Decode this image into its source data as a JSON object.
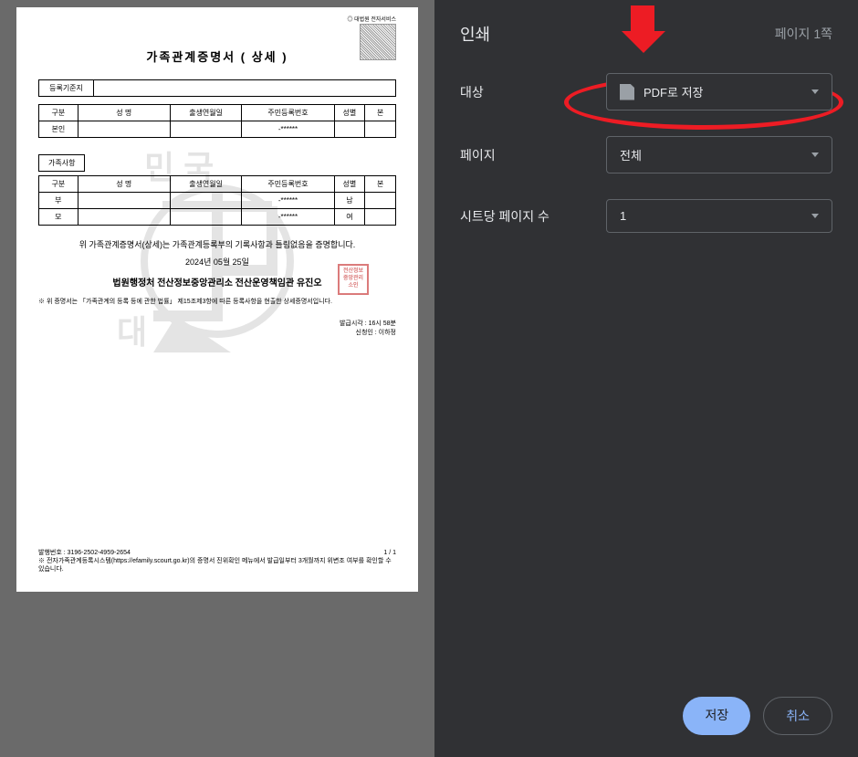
{
  "panel": {
    "title": "인쇄",
    "page_count": "페이지 1쪽",
    "destination_label": "대상",
    "destination_value": "PDF로 저장",
    "pages_label": "페이지",
    "pages_value": "전체",
    "per_sheet_label": "시트당 페이지 수",
    "per_sheet_value": "1",
    "save_btn": "저장",
    "cancel_btn": "취소"
  },
  "doc": {
    "title": "가족관계증명서 ( 상세 )",
    "register_row_label": "등록기준지",
    "table_headers": {
      "gubun": "구분",
      "name": "성  명",
      "birth": "출생연월일",
      "rrn": "주민등록번호",
      "gender": "성별",
      "bon": "본"
    },
    "self_row": {
      "gubun": "본인",
      "rrn": "-******"
    },
    "family_section": "가족사항",
    "family_rows": [
      {
        "gubun": "부",
        "rrn": "-******",
        "gender": "남"
      },
      {
        "gubun": "모",
        "rrn": "-******",
        "gender": "여"
      }
    ],
    "cert_text": "위 가족관계증명서(상세)는 가족관계등록부의 기록사항과 틀림없음을 증명합니다.",
    "cert_date": "2024년 05월 25일",
    "cert_issuer": "법원행정처 전산정보중앙관리소 전산운영책임관 유진오",
    "note": "※ 위 증명서는 「가족관계의 등록 등에 관한 법률」 제15조제3항에 따른 등록사항을 현출한 상세증명서입니다.",
    "issue_time_label": "발급시각 : ",
    "issue_time": "16시 58분",
    "applicant_label": "신청인 : ",
    "applicant": "이하정",
    "issue_no_label": "발행번호 : ",
    "issue_no": "3196-2502-4959-2654",
    "page_num": "1  /  1",
    "footer_note": "※ 전자가족관계등록시스템(https://efamily.scourt.go.kr)의 증명서 진위확인 메뉴에서 발급일부터 3개월까지 위변조 여부를 확인할 수 있습니다."
  }
}
